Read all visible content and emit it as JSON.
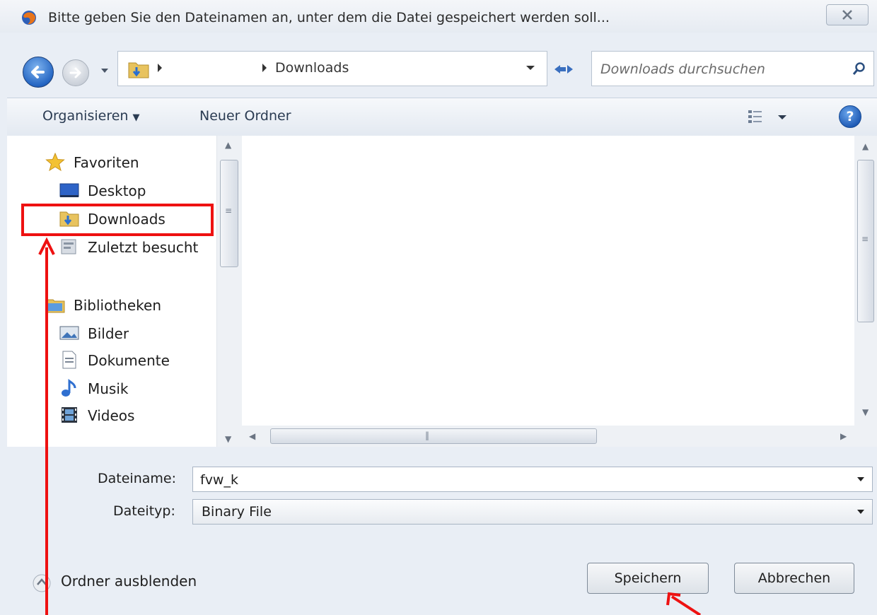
{
  "window": {
    "title": "Bitte geben Sie den Dateinamen an, unter dem die Datei gespeichert werden soll..."
  },
  "address_bar": {
    "current_folder": "Downloads"
  },
  "search": {
    "placeholder": "Downloads durchsuchen"
  },
  "toolbar": {
    "organize_label": "Organisieren",
    "new_folder_label": "Neuer Ordner"
  },
  "sidebar": {
    "favorites": {
      "label": "Favoriten",
      "items": [
        {
          "label": "Desktop",
          "icon": "desktop-icon"
        },
        {
          "label": "Downloads",
          "icon": "downloads-folder-icon"
        },
        {
          "label": "Zuletzt besucht",
          "icon": "recent-places-icon"
        }
      ]
    },
    "libraries": {
      "label": "Bibliotheken",
      "items": [
        {
          "label": "Bilder",
          "icon": "pictures-icon"
        },
        {
          "label": "Dokumente",
          "icon": "documents-icon"
        },
        {
          "label": "Musik",
          "icon": "music-icon"
        },
        {
          "label": "Videos",
          "icon": "videos-icon"
        }
      ]
    }
  },
  "form": {
    "filename_label": "Dateiname:",
    "filename_value": "fvw_k",
    "filetype_label": "Dateityp:",
    "filetype_value": "Binary File"
  },
  "footer": {
    "hide_folders_label": "Ordner ausblenden",
    "save_label": "Speichern",
    "cancel_label": "Abbrechen"
  },
  "colors": {
    "annotation": "#ee1111",
    "dialog_bg": "#e9eef5",
    "toolbar_text": "#2a3b52"
  }
}
